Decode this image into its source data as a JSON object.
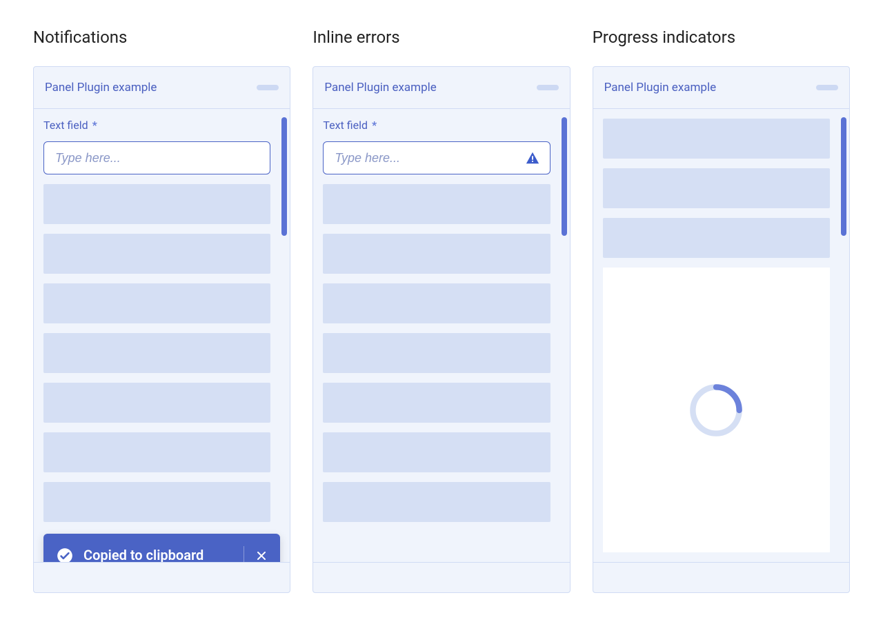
{
  "columns": {
    "notifications": {
      "title": "Notifications",
      "panel_title": "Panel Plugin example",
      "field_label": "Text field",
      "required_marker": "*",
      "input_placeholder": "Type here...",
      "toast_message": "Copied to clipboard"
    },
    "inline_errors": {
      "title": "Inline errors",
      "panel_title": "Panel Plugin example",
      "field_label": "Text field",
      "required_marker": "*",
      "input_placeholder": "Type here..."
    },
    "progress": {
      "title": "Progress indicators",
      "panel_title": "Panel Plugin example"
    }
  },
  "icons": {
    "check": "check-circle",
    "close": "close",
    "alert": "alert-triangle",
    "spinner": "loading-spinner"
  },
  "colors": {
    "accent": "#4a63c5",
    "panel_bg": "#f0f4fc",
    "placeholder_block": "#d5dff4",
    "scroll_thumb": "#5a72d5"
  }
}
